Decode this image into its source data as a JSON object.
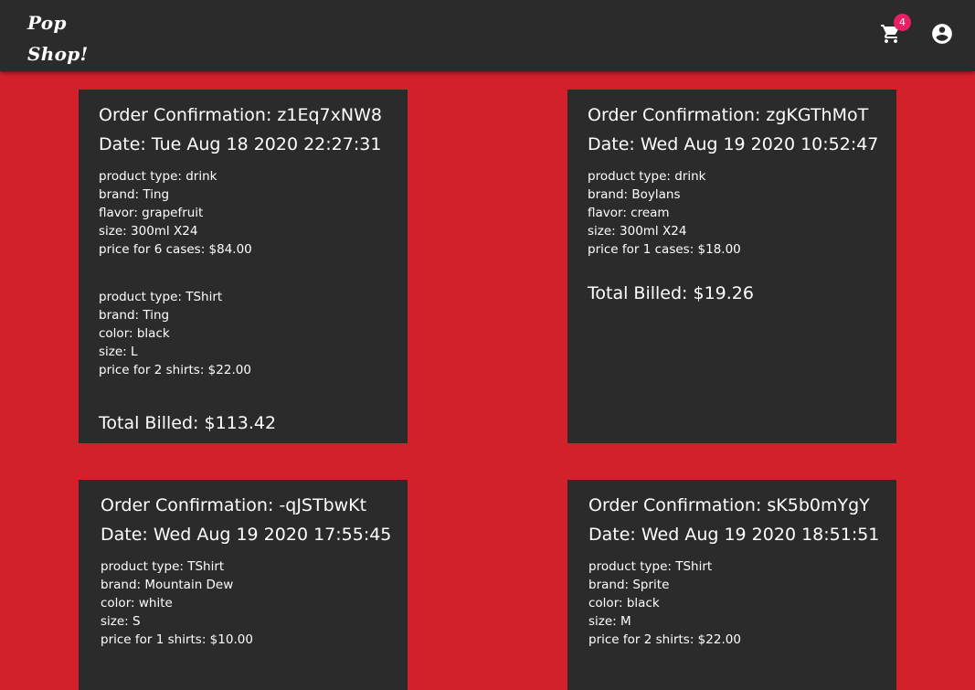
{
  "app": {
    "logo_line1": "Pop",
    "logo_line2": "Shop!",
    "cart_badge": "4",
    "cart_icon": "shopping-cart-icon",
    "account_icon": "account-circle-icon"
  },
  "colors": {
    "background": "#d3212c",
    "appbar": "#2b2b2b",
    "card": "#2b2b2b",
    "badge": "#e91e63",
    "text": "#ffffff"
  },
  "orders": [
    {
      "confirmation": "Order Confirmation: z1Eq7xNW8",
      "date": "Date: Tue Aug 18 2020 22:27:31",
      "items": [
        {
          "lines": [
            "product type: drink",
            "brand: Ting",
            "flavor: grapefruit",
            "size: 300ml X24",
            "price for 6 cases: $84.00"
          ]
        },
        {
          "lines": [
            "product type: TShirt",
            "brand: Ting",
            "color: black",
            "size: L",
            "price for 2 shirts: $22.00"
          ]
        }
      ],
      "total": "Total Billed: $113.42"
    },
    {
      "confirmation": "Order Confirmation: zgKGThMoT",
      "date": "Date: Wed Aug 19 2020 10:52:47",
      "items": [
        {
          "lines": [
            "product type: drink",
            "brand: Boylans",
            "flavor: cream",
            "size: 300ml X24",
            "price for 1 cases: $18.00"
          ]
        }
      ],
      "total": "Total Billed: $19.26"
    },
    {
      "confirmation": "Order Confirmation: -qJSTbwKt",
      "date": "Date: Wed Aug 19 2020 17:55:45",
      "items": [
        {
          "lines": [
            "product type: TShirt",
            "brand: Mountain Dew",
            "color: white",
            "size: S",
            "price for 1 shirts: $10.00"
          ]
        }
      ]
    },
    {
      "confirmation": "Order Confirmation: sK5b0mYgY",
      "date": "Date: Wed Aug 19 2020 18:51:51",
      "items": [
        {
          "lines": [
            "product type: TShirt",
            "brand: Sprite",
            "color: black",
            "size: M",
            "price for 2 shirts: $22.00"
          ]
        }
      ]
    }
  ]
}
